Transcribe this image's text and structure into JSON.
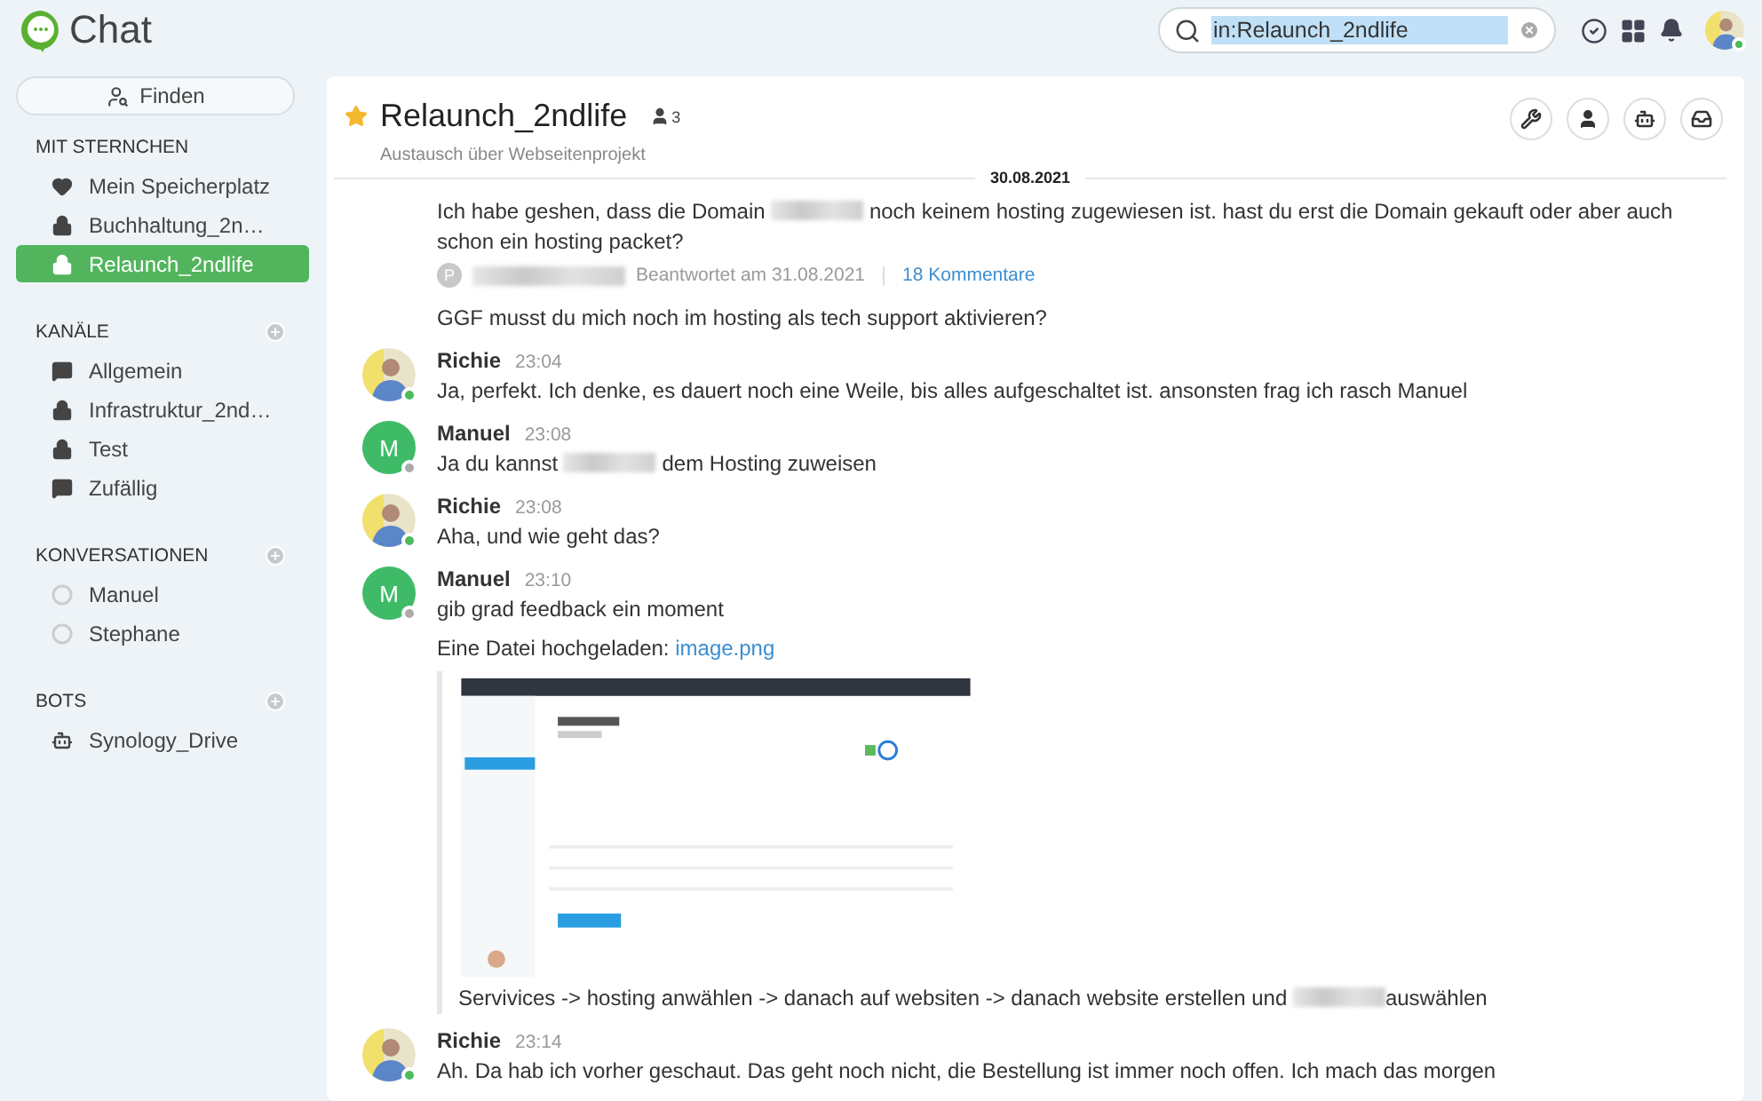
{
  "app": {
    "title": "Chat"
  },
  "search": {
    "value": "in:Relaunch_2ndlife"
  },
  "top_icons": [
    {
      "kind": "check"
    },
    {
      "kind": "grid"
    },
    {
      "kind": "bell"
    }
  ],
  "user": {
    "online": true
  },
  "sidebar": {
    "find_button": "Finden",
    "sections": [
      {
        "title": "MIT STERNCHEN",
        "addable": false,
        "items": [
          {
            "label": "Mein Speicherplatz",
            "kind": "heart",
            "selected": false
          },
          {
            "label": "Buchhaltung_2n…",
            "kind": "lock",
            "selected": false
          },
          {
            "label": "Relaunch_2ndlife",
            "kind": "lock",
            "selected": true
          }
        ]
      },
      {
        "title": "KANÄLE",
        "addable": true,
        "items": [
          {
            "label": "Allgemein",
            "kind": "chat",
            "selected": false
          },
          {
            "label": "Infrastruktur_2nd…",
            "kind": "lock",
            "selected": false
          },
          {
            "label": "Test",
            "kind": "lock",
            "selected": false
          },
          {
            "label": "Zufällig",
            "kind": "chat",
            "selected": false
          }
        ]
      },
      {
        "title": "KONVERSATIONEN",
        "addable": true,
        "items": [
          {
            "label": "Manuel",
            "kind": "circle",
            "selected": false
          },
          {
            "label": "Stephane",
            "kind": "circle",
            "selected": false
          }
        ]
      },
      {
        "title": "BOTS",
        "addable": true,
        "items": [
          {
            "label": "Synology_Drive",
            "kind": "bot",
            "selected": false
          }
        ]
      }
    ]
  },
  "channel": {
    "title": "Relaunch_2ndlife",
    "starred": true,
    "members": "3",
    "description": "Austausch über Webseitenprojekt",
    "actions": [
      {
        "kind": "wrench"
      },
      {
        "kind": "user"
      },
      {
        "kind": "bot"
      },
      {
        "kind": "inbox"
      }
    ]
  },
  "date_divider": "30.08.2021",
  "messages": [
    {
      "kind": "continued",
      "parts": [
        {
          "kind": "text",
          "text": "Ich habe geshen, dass die Domain "
        },
        {
          "kind": "redacted"
        },
        {
          "kind": "text",
          "text": " noch keinem hosting zugewiesen ist. hast du erst die Domain gekauft oder aber auch schon ein hosting packet?"
        }
      ],
      "reply": {
        "initial": "P",
        "answered": "Beantwortet am 31.08.2021",
        "comments": "18 Kommentare"
      }
    },
    {
      "kind": "continued",
      "parts": [
        {
          "kind": "text",
          "text": "GGF musst du mich noch im hosting als tech support aktivieren?"
        }
      ]
    },
    {
      "kind": "message",
      "author": "Richie",
      "online": true,
      "time": "23:04",
      "parts": [
        {
          "kind": "text",
          "text": "Ja, perfekt. Ich denke, es dauert noch eine Weile, bis alles aufgeschaltet ist. ansonsten frag ich rasch Manuel"
        }
      ]
    },
    {
      "kind": "message",
      "author": "Manuel",
      "initial": "M",
      "online": false,
      "time": "23:08",
      "parts": [
        {
          "kind": "text",
          "text": "Ja du kannst "
        },
        {
          "kind": "redacted"
        },
        {
          "kind": "text",
          "text": " dem Hosting zuweisen"
        }
      ]
    },
    {
      "kind": "message",
      "author": "Richie",
      "online": true,
      "time": "23:08",
      "parts": [
        {
          "kind": "text",
          "text": "Aha, und wie geht das?"
        }
      ]
    },
    {
      "kind": "message",
      "author": "Manuel",
      "initial": "M",
      "online": false,
      "time": "23:10",
      "parts": [
        {
          "kind": "text",
          "text": "gib grad feedback ein moment"
        }
      ]
    },
    {
      "kind": "upload",
      "label": "Eine Datei hochgeladen: ",
      "file": "image.png",
      "caption": [
        {
          "kind": "text",
          "text": "Servivices -> hosting anwählen -> danach auf websiten -> danach website erstellen und "
        },
        {
          "kind": "redacted"
        },
        {
          "kind": "text",
          "text": "auswählen"
        }
      ]
    },
    {
      "kind": "message",
      "author": "Richie",
      "online": true,
      "time": "23:14",
      "parts": [
        {
          "kind": "text",
          "text": "Ah. Da hab ich vorher geschaut. Das geht noch nicht, die Bestellung ist immer noch offen. Ich mach das morgen"
        }
      ]
    }
  ]
}
